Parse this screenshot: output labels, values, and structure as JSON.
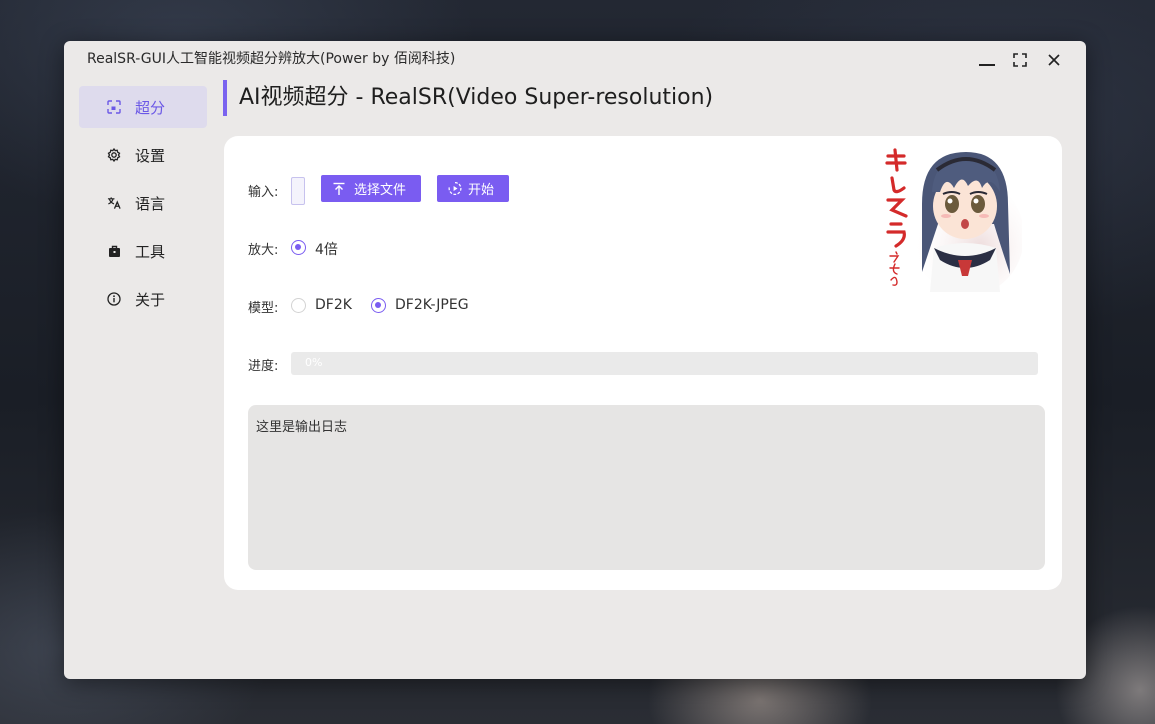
{
  "window": {
    "title": "RealSR-GUI人工智能视频超分辨放大(Power by 佰阅科技)",
    "controls": [
      "minimize-icon",
      "maximize-icon",
      "close-icon"
    ]
  },
  "sidebar": {
    "items": [
      {
        "label": "超分",
        "icon": "super-resolution-icon",
        "active": true
      },
      {
        "label": "设置",
        "icon": "gear-icon",
        "active": false
      },
      {
        "label": "语言",
        "icon": "translate-icon",
        "active": false
      },
      {
        "label": "工具",
        "icon": "toolbox-icon",
        "active": false
      },
      {
        "label": "关于",
        "icon": "info-icon",
        "active": false
      }
    ]
  },
  "header": {
    "title": "AI视频超分 - RealSR(Video Super-resolution)"
  },
  "form": {
    "input_label": "输入:",
    "input_value": "",
    "select_file_label": "选择文件",
    "start_label": "开始",
    "scale_label": "放大:",
    "scale_options": [
      {
        "label": "4倍",
        "selected": true
      }
    ],
    "model_label": "模型:",
    "model_options": [
      {
        "label": "DF2K",
        "selected": false
      },
      {
        "label": "DF2K-JPEG",
        "selected": true
      }
    ],
    "progress_label": "进度:",
    "progress_value": 0,
    "progress_text": "0%",
    "log_text": "这里是输出日志"
  },
  "mascot": {
    "caption_vertical": "キレそうですわ"
  },
  "colors": {
    "accent": "#7a5cf1",
    "window_bg": "#ebe9e8",
    "card_bg": "#ffffff",
    "active_nav_bg": "#dedbed"
  }
}
